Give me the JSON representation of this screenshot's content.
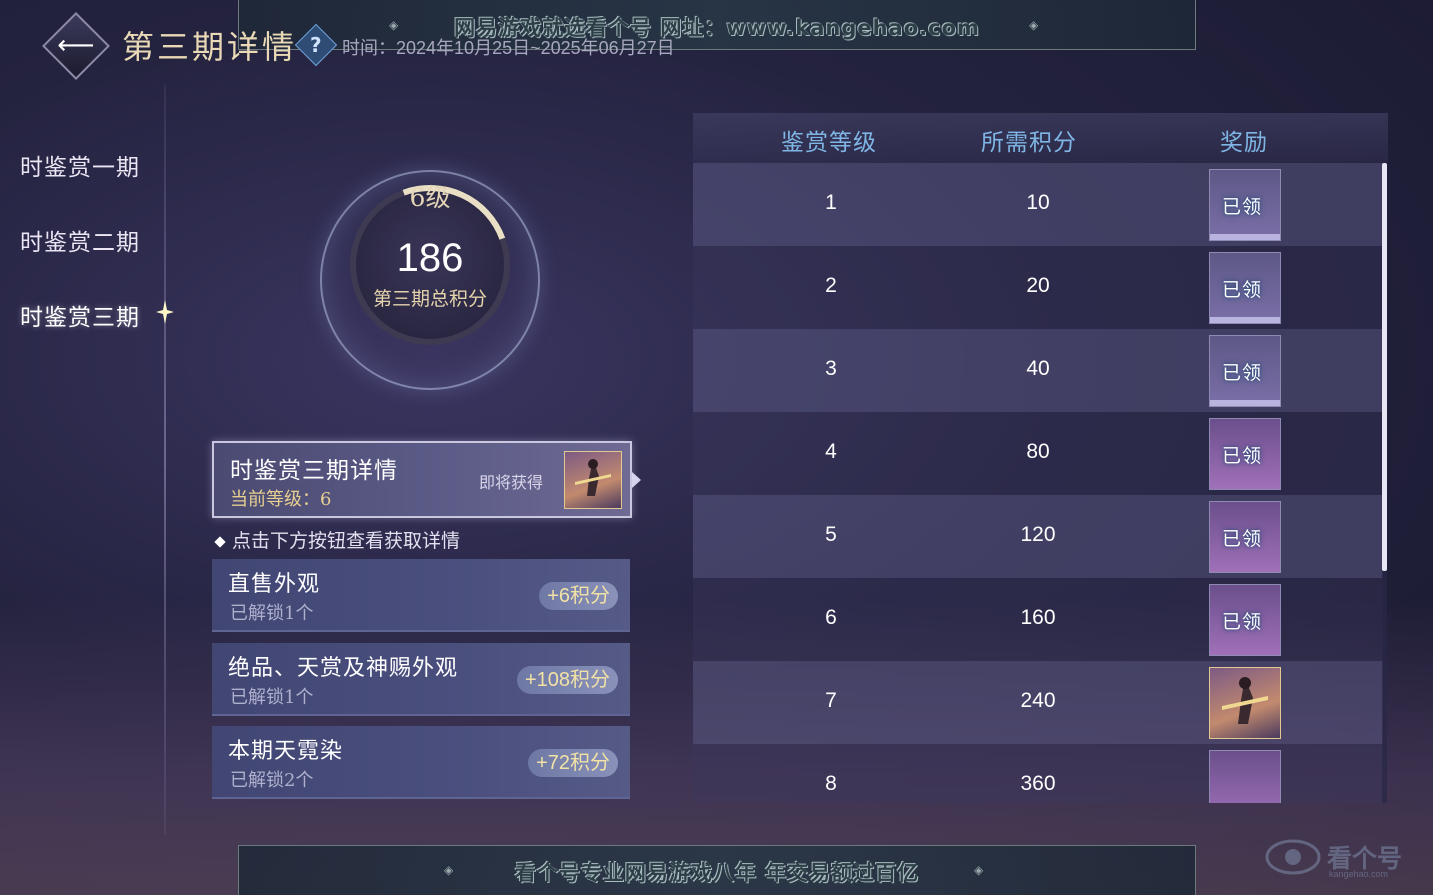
{
  "watermark_top": "网易游戏就选看个号  网址：www.kangehao.com",
  "watermark_bottom": "看个号专业网易游戏八年  年交易额过百亿",
  "header": {
    "title": "第三期详情",
    "time": "时间：2024年10月25日~2025年06月27日"
  },
  "sidebar": {
    "items": [
      {
        "label": "时鉴赏一期"
      },
      {
        "label": "时鉴赏二期"
      },
      {
        "label": "时鉴赏三期"
      }
    ]
  },
  "score": {
    "level": "6级",
    "value": "186",
    "caption": "第三期总积分"
  },
  "detail": {
    "title": "时鉴赏三期详情",
    "current_level": "当前等级：6",
    "soon": "即将获得"
  },
  "hint": "点击下方按钮查看获取详情",
  "unlock_cards": [
    {
      "title": "直售外观",
      "sub": "已解锁1个",
      "badge": "+6积分"
    },
    {
      "title": "绝品、天赏及神赐外观",
      "sub": "已解锁1个",
      "badge": "+108积分"
    },
    {
      "title": "本期天霓染",
      "sub": "已解锁2个",
      "badge": "+72积分"
    }
  ],
  "table": {
    "headers": [
      "鉴赏等级",
      "所需积分",
      "奖励"
    ],
    "rows": [
      {
        "level": "1",
        "points": "10",
        "reward": "已领",
        "claimed": true
      },
      {
        "level": "2",
        "points": "20",
        "reward": "已领",
        "claimed": true
      },
      {
        "level": "3",
        "points": "40",
        "reward": "已领",
        "claimed": true
      },
      {
        "level": "4",
        "points": "80",
        "reward": "已领",
        "claimed": true
      },
      {
        "level": "5",
        "points": "120",
        "reward": "已领",
        "claimed": true
      },
      {
        "level": "6",
        "points": "160",
        "reward": "已领",
        "claimed": true
      },
      {
        "level": "7",
        "points": "240",
        "reward": "",
        "claimed": false
      },
      {
        "level": "8",
        "points": "360",
        "reward": "",
        "claimed": false
      }
    ]
  },
  "brand": {
    "name": "看个号",
    "domain": "kangehao.com"
  },
  "colors": {
    "accent_gold": "#e6cf8f",
    "header_blue": "#7fb6e6",
    "badge_gold": "#f2e2a6"
  }
}
